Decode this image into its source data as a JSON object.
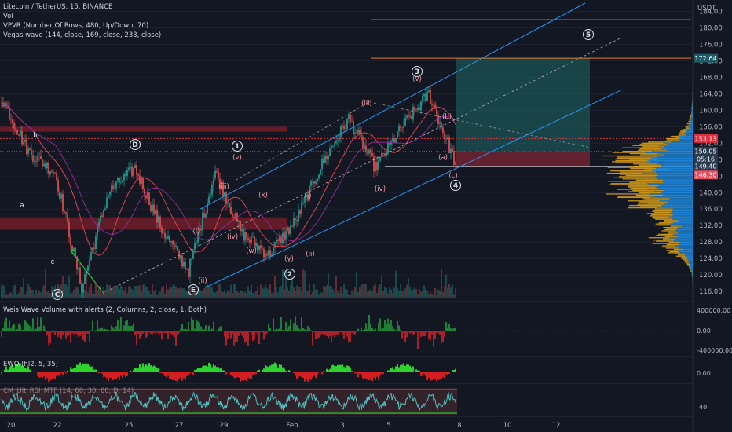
{
  "header": {
    "symbol_line": "Litecoin / TetherUS, 15, BINANCE",
    "indicators": [
      "Vol",
      "VPVR (Number Of Rows, 480, Up/Down, 70)",
      "Vegas wave (144, close, 169, close, 233, close)"
    ]
  },
  "axis": {
    "currency": "USDT",
    "price_ticks": [
      184,
      180,
      176,
      172,
      168,
      164,
      160,
      156,
      152,
      148,
      144,
      140,
      136,
      132,
      128,
      124,
      120,
      116
    ],
    "price_range": [
      114.5,
      186
    ],
    "date_ticks": [
      "20",
      "22",
      "25",
      "27",
      "29",
      "Feb",
      "3",
      "5",
      "8",
      "10",
      "12"
    ]
  },
  "price_labels": [
    {
      "text": "172.64",
      "price": 172.64,
      "bg": "#1e5a63"
    },
    {
      "text": "153.13",
      "price": 153.13,
      "bg": "#e03040"
    },
    {
      "text": "150.05",
      "price": 150.05,
      "bg": "#2a3b4f"
    },
    {
      "text": "05:16",
      "price": 148.2,
      "bg": "#2a3b4f"
    },
    {
      "text": "149.40",
      "price": 146.4,
      "bg": "#2a3b4f"
    },
    {
      "text": "146.30",
      "price": 144.3,
      "bg": "#e05060"
    }
  ],
  "wave_labels": {
    "circled": [
      "C",
      "D",
      "1",
      "E",
      "2",
      "3",
      "4",
      "5"
    ],
    "lower": [
      "a",
      "b",
      "c"
    ],
    "paren": [
      "(i)",
      "(ii)",
      "(iii)",
      "(iv)",
      "(v)",
      "(w)",
      "(x)",
      "(y)",
      "(i)",
      "(ii)",
      "(iii)",
      "(iv)",
      "(v)",
      "(a)",
      "(b)",
      "(c)"
    ]
  },
  "panels": [
    {
      "title": "Weis Wave Volume with alerts (2, Columns, 2, close, 1, Both)",
      "ticks": [
        "400000.00",
        "0.00",
        "-400000.00"
      ]
    },
    {
      "title": "EWO (hl2, 5, 35)",
      "ticks": [
        "0.00"
      ]
    },
    {
      "title": "CM_Ult_RSI_MTF (14, 60, 30, 60, D, 14)",
      "ticks": [
        "40"
      ]
    }
  ],
  "colors": {
    "up": "#26a69a",
    "down": "#ef5350",
    "blue_channel": "#2196f3",
    "vpvr_up": "#2196f3",
    "vpvr_down": "#e6a817",
    "target_box": "#1f6a66",
    "stop_box": "#6b2230"
  },
  "chart_data": {
    "type": "candlestick",
    "title": "Litecoin / TetherUS, 15, BINANCE",
    "ylabel": "USDT",
    "ylim": [
      114.5,
      186
    ],
    "x_ticks": [
      "20",
      "22",
      "25",
      "27",
      "29",
      "Feb",
      "3",
      "5",
      "8",
      "10",
      "12"
    ],
    "key_prices": [
      172.64,
      153.13,
      150.05,
      149.4,
      146.3
    ],
    "approx_path": [
      {
        "x": "20",
        "price": 163
      },
      {
        "x": "20",
        "price": 150
      },
      {
        "x": "21",
        "price": 145
      },
      {
        "x": "22",
        "price": 117
      },
      {
        "x": "23",
        "price": 140
      },
      {
        "x": "24",
        "price": 146
      },
      {
        "x": "26",
        "price": 131
      },
      {
        "x": "27",
        "price": 121
      },
      {
        "x": "29",
        "price": 145
      },
      {
        "x": "30",
        "price": 130
      },
      {
        "x": "31",
        "price": 125
      },
      {
        "x": "Feb",
        "price": 133
      },
      {
        "x": "2",
        "price": 147
      },
      {
        "x": "3",
        "price": 158
      },
      {
        "x": "4",
        "price": 146
      },
      {
        "x": "5",
        "price": 156
      },
      {
        "x": "6",
        "price": 164
      },
      {
        "x": "7",
        "price": 147
      }
    ]
  }
}
